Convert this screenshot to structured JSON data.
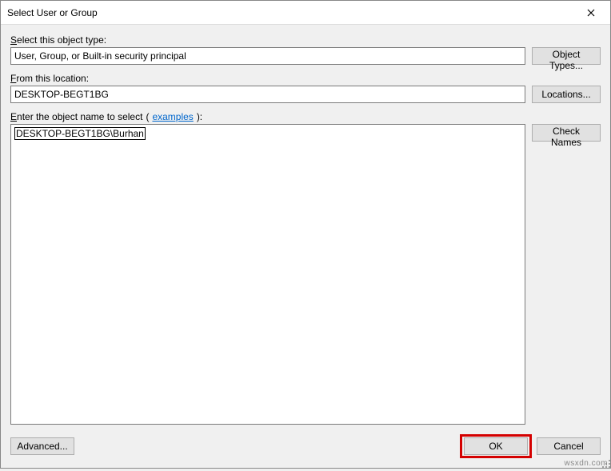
{
  "window": {
    "title": "Select User or Group"
  },
  "objectType": {
    "label": "Select this object type:",
    "value": "User, Group, or Built-in security principal",
    "button": "Object Types..."
  },
  "location": {
    "label": "From this location:",
    "value": "DESKTOP-BEGT1BG",
    "button": "Locations..."
  },
  "objectName": {
    "label": "Enter the object name to select",
    "examplesLink": "examples",
    "value": "DESKTOP-BEGT1BG\\Burhan",
    "checkButton": "Check Names"
  },
  "buttons": {
    "advanced": "Advanced...",
    "ok": "OK",
    "cancel": "Cancel"
  },
  "watermark": "wsxdn.com"
}
